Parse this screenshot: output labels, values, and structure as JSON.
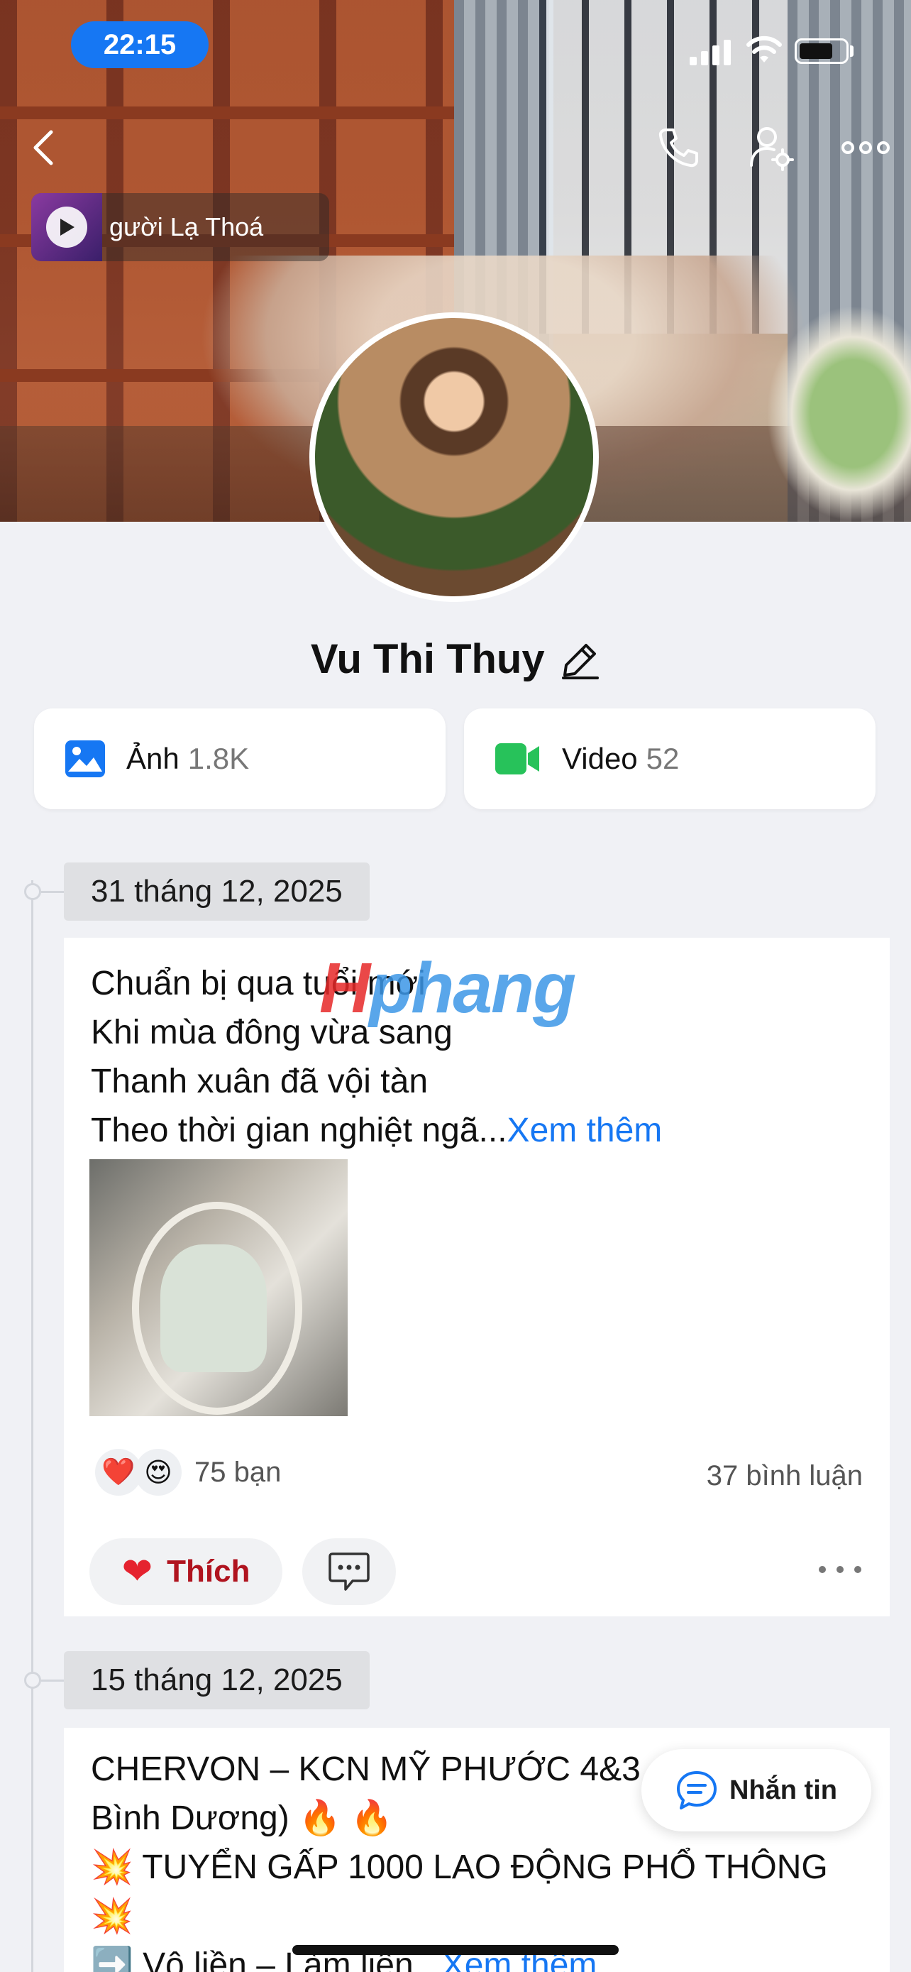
{
  "status_bar": {
    "time": "22:15"
  },
  "cover": {
    "music_title": "gười Lạ Thoá"
  },
  "profile": {
    "name": "Vu Thi Thuy"
  },
  "media": {
    "photos": {
      "label": "Ảnh",
      "count": "1.8K"
    },
    "videos": {
      "label": "Video",
      "count": "52"
    }
  },
  "watermark": {
    "lead": "H",
    "rest": "phang"
  },
  "posts": [
    {
      "date": "31 tháng 12, 2025",
      "lines": [
        "Chuẩn bị qua tuổi mới",
        "Khi mùa đông vừa sang",
        "Thanh xuân đã vội tàn",
        "Theo thời gian nghiệt ngã..."
      ],
      "more": "Xem thêm",
      "reactions": [
        "❤️",
        "😍"
      ],
      "reaction_count": "75 bạn",
      "comment_count": "37 bình luận",
      "like_label": "Thích"
    },
    {
      "date": "15 tháng 12, 2025",
      "lines": [
        "CHERVON – KCN MỸ PHƯỚC 4&3",
        "Bình Dương) 🔥 🔥",
        "💥 TUYỂN GẤP 1000 LAO ĐỘNG PHỔ THÔNG",
        "💥",
        "➡️ Vô liền – Làm liền..."
      ],
      "more": "Xem thêm"
    }
  ],
  "message_button": {
    "label": "Nhắn tin"
  },
  "colors": {
    "accent": "#1677f3",
    "like_red": "#e5232f",
    "video_green": "#27c25a"
  }
}
